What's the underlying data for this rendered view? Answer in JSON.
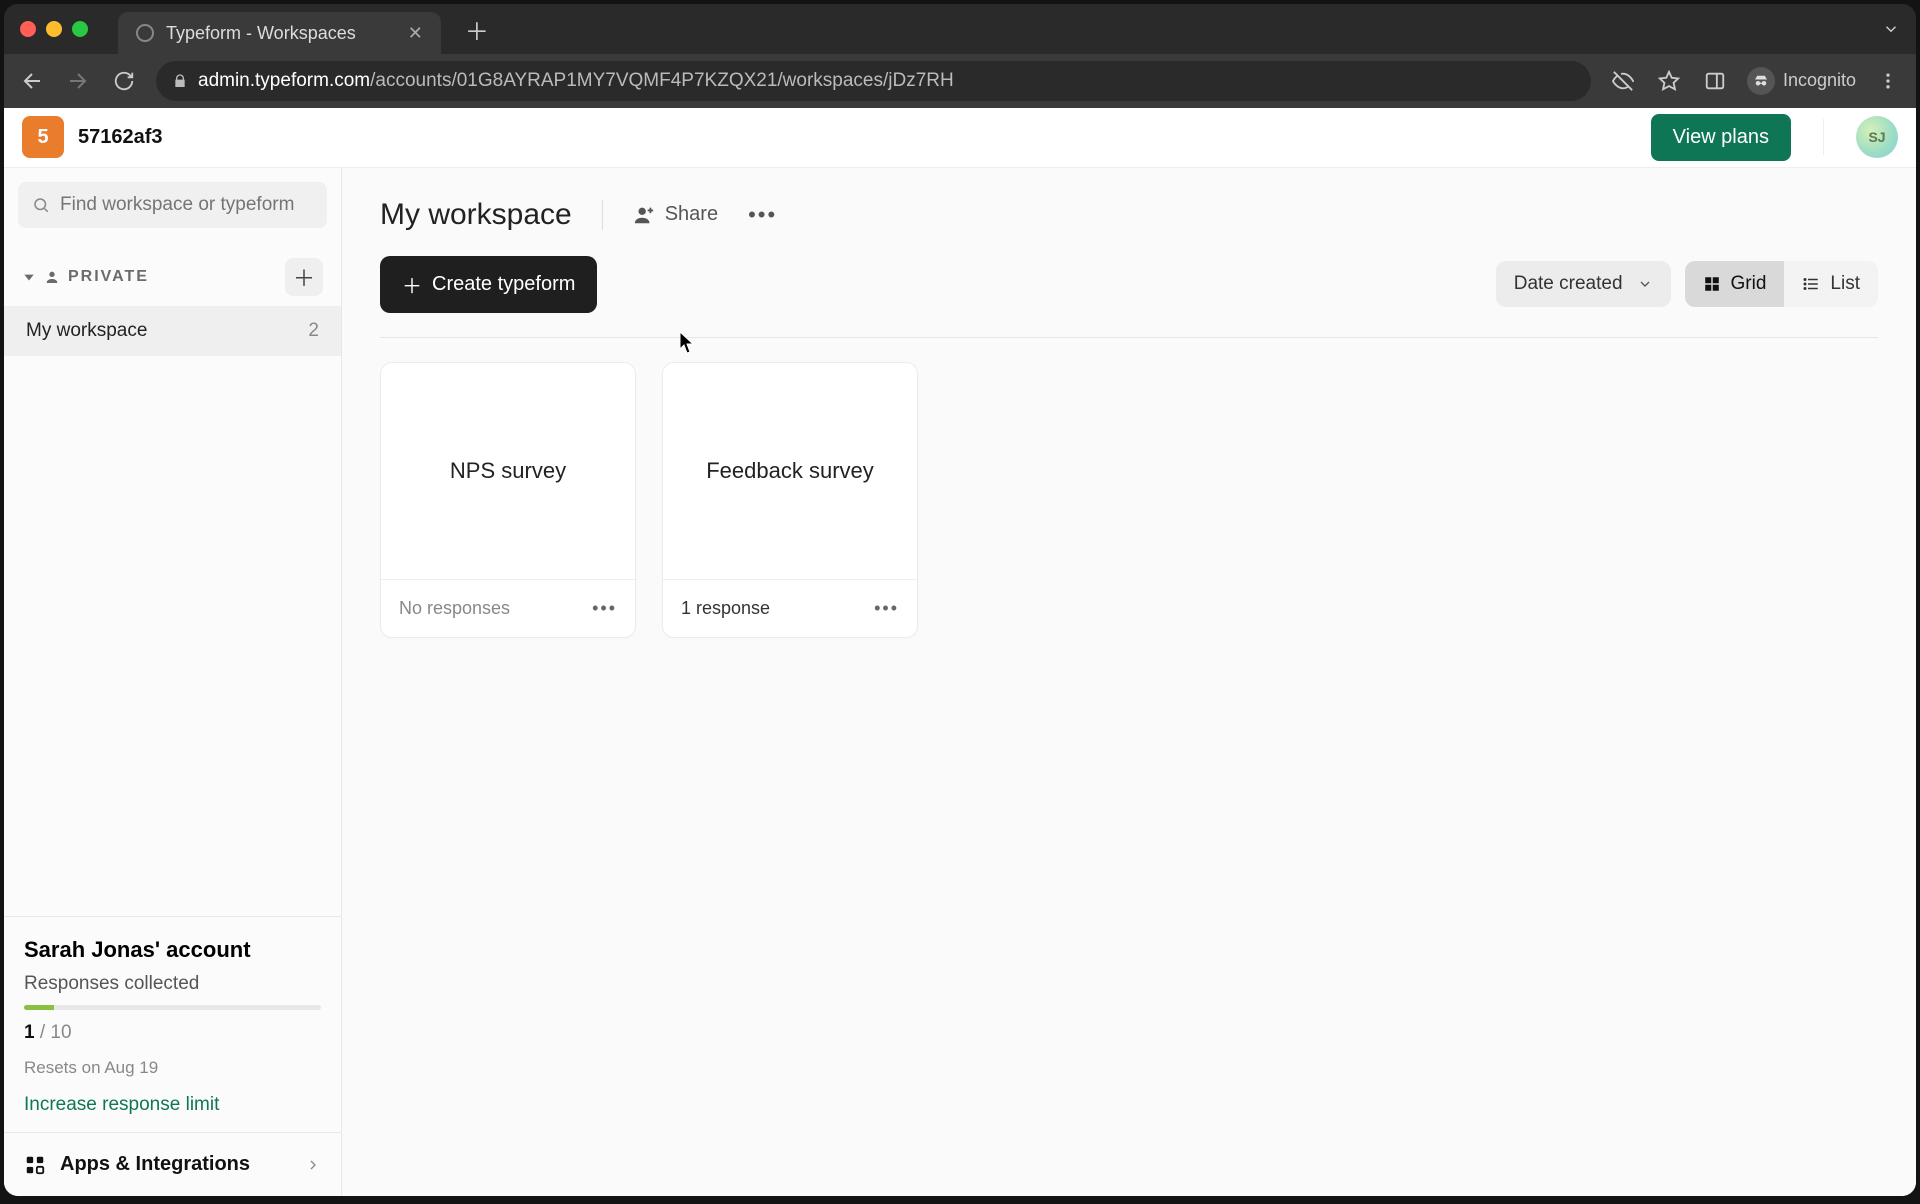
{
  "browser": {
    "tab_title": "Typeform - Workspaces",
    "url_host": "admin.typeform.com",
    "url_path": "/accounts/01G8AYRAP1MY7VQMF4P7KZQX21/workspaces/jDz7RH",
    "incognito_label": "Incognito"
  },
  "topbar": {
    "org_badge": "5",
    "org_name": "57162af3",
    "view_plans": "View plans",
    "avatar_initials": "SJ"
  },
  "sidebar": {
    "search_placeholder": "Find workspace or typeform",
    "section_label": "PRIVATE",
    "workspace": {
      "name": "My workspace",
      "count": "2"
    },
    "account": {
      "title": "Sarah Jonas' account",
      "responses_label": "Responses collected",
      "responses_current": "1",
      "responses_sep": " / ",
      "responses_limit": "10",
      "resets": "Resets on Aug 19",
      "increase": "Increase response limit"
    },
    "apps_label": "Apps & Integrations"
  },
  "main": {
    "title": "My workspace",
    "share": "Share",
    "create": "Create typeform",
    "sort": "Date created",
    "view_grid": "Grid",
    "view_list": "List",
    "cards": [
      {
        "title": "NPS survey",
        "status": "No responses",
        "has_responses": false
      },
      {
        "title": "Feedback survey",
        "status": "1 response",
        "has_responses": true
      }
    ]
  }
}
